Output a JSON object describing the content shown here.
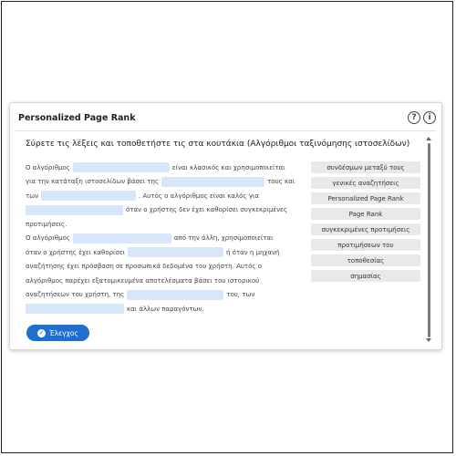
{
  "widget": {
    "title": "Personalized Page Rank",
    "help_icon": "?",
    "info_icon": "i",
    "instruction": "Σύρετε τις λέξεις και τοποθετήστε τις στα κουτάκια (Αλγόριθμοι ταξινόμησης ιστοσελίδων)"
  },
  "passage": [
    {
      "a": "Ο αλγόριθμος",
      "b": "είναι κλασικός και χρησιμοποιείται"
    },
    {
      "a": "για την κατάταξη ιστοσελίδων βάσει της",
      "b": "τους και"
    },
    {
      "a": "των",
      "b": ". Αυτός ο αλγόριθμος είναι καλός για"
    },
    {
      "a": "",
      "b": "όταν ο χρήστης δεν έχει καθορίσει συγκεκριμένες"
    },
    {
      "a": "προτιμήσεις."
    },
    {
      "a": "Ο αλγόριθμος",
      "b": "από την άλλη, χρησιμοποιείται"
    },
    {
      "a": "όταν ο χρήστης έχει καθορίσει",
      "b": "ή όταν η μηχανή"
    },
    {
      "a": "αναζήτησης έχει πρόσβαση σε προσωπικά δεδομένα του χρήστη. Αυτός ο"
    },
    {
      "a": "αλγόριθμος παρέχει εξατομικευμένα αποτελέσματα βάσει του ιστορικού"
    },
    {
      "a": "αναζητήσεων του χρήστη, της",
      "b": "του, των"
    },
    {
      "a": "",
      "b": "και άλλων παραγόντων."
    }
  ],
  "word_bank": [
    "συνδέσμων μεταξύ τους",
    "γενικές αναζητήσεις",
    "Personalized Page Rank",
    "Page Rank",
    "συγκεκριμένες προτιμήσεις",
    "προτιμήσεων του",
    "τοποθεσίας",
    "σημασίας"
  ],
  "check_button": {
    "label": "Έλεγχος",
    "icon": "check-icon"
  },
  "colors": {
    "accent": "#1f6fd1",
    "blank": "#d7e6fb",
    "chip": "#e9e9e9"
  }
}
